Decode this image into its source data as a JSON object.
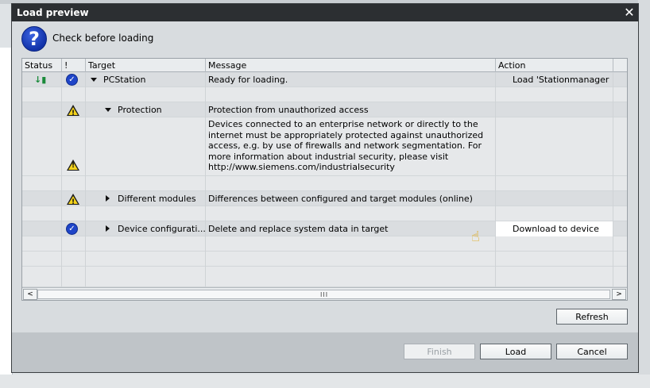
{
  "dialog": {
    "title": "Load preview",
    "header_text": "Check before loading",
    "close_glyph": "✕"
  },
  "table": {
    "columns": [
      "Status",
      "!",
      "Target",
      "Message",
      "Action"
    ],
    "rows": [
      {
        "status_icon": "download-to-device-icon",
        "flag_icon": "check-warning-icon",
        "target": "PCStation",
        "target_expander": "expanded",
        "message": "Ready for loading.",
        "action": "Load 'Stationmanager"
      },
      {
        "target": "",
        "message": "",
        "action": ""
      },
      {
        "flag_icon": "warning-icon",
        "target": "Protection",
        "target_expander": "expanded",
        "message": "Protection from unauthorized access",
        "action": ""
      },
      {
        "flag_icon": "warning-icon",
        "target": "",
        "message": "Devices connected to an enterprise network or directly to the internet must be appropriately protected against unauthorized access, e.g. by use of firewalls and network segmentation. For more information about industrial security, please visit http://www.siemens.com/industrialsecurity",
        "action": ""
      },
      {
        "flag_icon": "warning-icon",
        "target": "Different modules",
        "target_expander": "collapsed",
        "message": "Differences between configured and target modules (online)",
        "action": ""
      },
      {
        "flag_icon": "check-icon",
        "target": "Device configurati...",
        "target_expander": "collapsed",
        "message": "Delete and replace system data in target",
        "action": "Download to device"
      }
    ]
  },
  "scrollbar": {
    "left_arrow": "<",
    "right_arrow": ">",
    "grip": "III"
  },
  "buttons": {
    "refresh": "Refresh",
    "finish": "Finish",
    "load": "Load",
    "cancel": "Cancel"
  },
  "colors": {
    "titlebar": "#2c2f32",
    "dialog_bg": "#d8dcdf",
    "footer_bg": "#bfc4c8",
    "accent_blue": "#1f45c8",
    "warning_yellow": "#f3d21c"
  }
}
